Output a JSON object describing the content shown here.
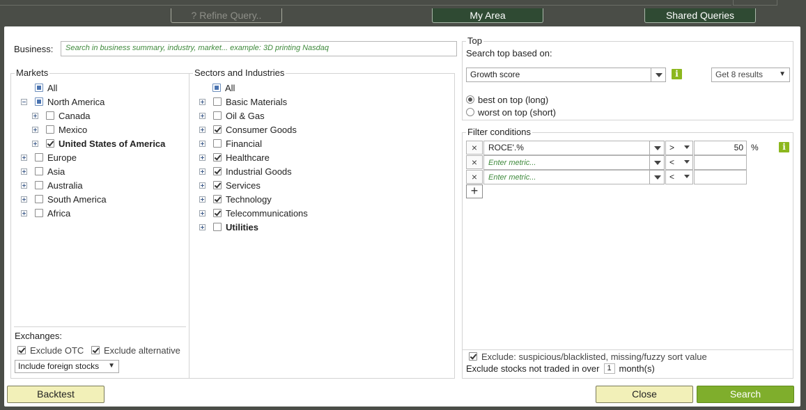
{
  "nav": {
    "refine": "?  Refine Query..",
    "my_area": "My Area",
    "shared": "Shared Queries"
  },
  "business": {
    "label": "Business:",
    "placeholder": "Search in business summary, industry, market...  example: 3D printing Nasdaq"
  },
  "markets": {
    "legend": "Markets",
    "all": "All",
    "items": [
      {
        "label": "North America"
      },
      {
        "label": "Canada"
      },
      {
        "label": "Mexico"
      },
      {
        "label": "United States of America"
      },
      {
        "label": "Europe"
      },
      {
        "label": "Asia"
      },
      {
        "label": "Australia"
      },
      {
        "label": "South America"
      },
      {
        "label": "Africa"
      }
    ]
  },
  "exchanges": {
    "label": "Exchanges:",
    "exclude_otc": "Exclude OTC",
    "exclude_alt": "Exclude alternative",
    "foreign": "Include foreign stocks"
  },
  "sectors": {
    "legend": "Sectors and Industries",
    "all": "All",
    "items": [
      {
        "label": "Basic Materials"
      },
      {
        "label": "Oil & Gas"
      },
      {
        "label": "Consumer Goods"
      },
      {
        "label": "Financial"
      },
      {
        "label": "Healthcare"
      },
      {
        "label": "Industrial Goods"
      },
      {
        "label": "Services"
      },
      {
        "label": "Technology"
      },
      {
        "label": "Telecommunications"
      },
      {
        "label": "Utilities"
      }
    ]
  },
  "top": {
    "legend": "Top",
    "search_label": "Search top based on:",
    "score": "Growth score",
    "results": "Get 8 results",
    "best": "best on top (long)",
    "worst": "worst on top (short)",
    "info": "i"
  },
  "filters": {
    "legend": "Filter conditions",
    "rows": [
      {
        "metric": "ROCE'.%",
        "op": ">",
        "value": "50",
        "unit": "%"
      },
      {
        "metric": "Enter metric...",
        "op": "<",
        "value": ""
      },
      {
        "metric": "Enter metric...",
        "op": "<",
        "value": ""
      }
    ],
    "x": "×",
    "add": "+",
    "info": "i"
  },
  "footer": {
    "exclude_label": "Exclude: suspicious/blacklisted, missing/fuzzy sort value",
    "not_traded_prefix": "Exclude stocks not traded in over",
    "months_value": "1",
    "not_traded_suffix": "month(s)"
  },
  "buttons": {
    "backtest": "Backtest",
    "close": "Close",
    "search": "Search"
  }
}
